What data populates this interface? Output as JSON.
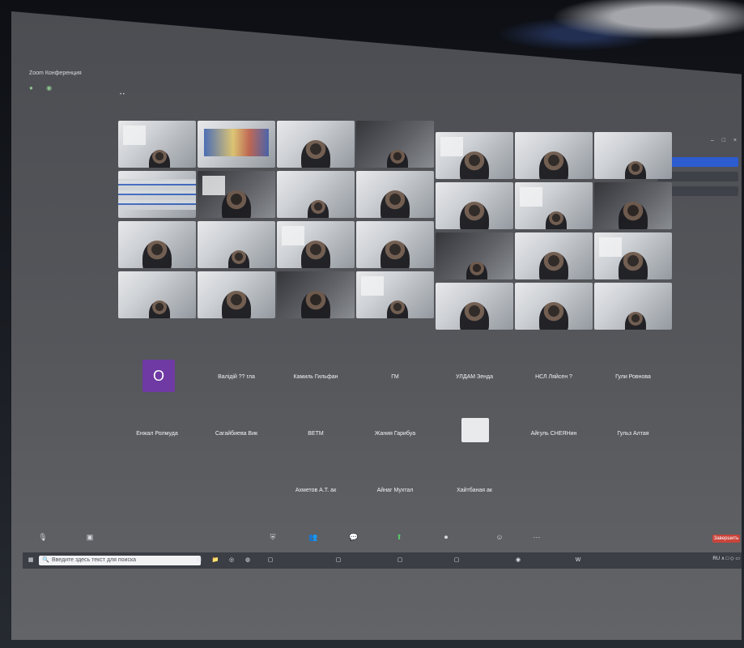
{
  "app": {
    "title": "Zoom Конференция"
  },
  "window": {
    "controls": [
      "–",
      "□",
      "×"
    ]
  },
  "view": {
    "dots": "• •"
  },
  "chat_panel": {
    "items": [
      {
        "label": ""
      },
      {
        "label": ""
      },
      {
        "label": ""
      }
    ]
  },
  "video_tiles": [
    {
      "kind": "person"
    },
    {
      "kind": "banner"
    },
    {
      "kind": "person"
    },
    {
      "kind": "person"
    },
    {
      "kind": "person"
    },
    {
      "kind": "person"
    },
    {
      "kind": "person"
    },
    {
      "kind": "shelf"
    },
    {
      "kind": "person"
    },
    {
      "kind": "person"
    },
    {
      "kind": "person"
    },
    {
      "kind": "person"
    },
    {
      "kind": "person"
    },
    {
      "kind": "person"
    },
    {
      "kind": "person"
    },
    {
      "kind": "person"
    },
    {
      "kind": "person"
    },
    {
      "kind": "person"
    },
    {
      "kind": "person"
    },
    {
      "kind": "person"
    },
    {
      "kind": "person"
    },
    {
      "kind": "person"
    },
    {
      "kind": "person"
    },
    {
      "kind": "person"
    },
    {
      "kind": "person"
    },
    {
      "kind": "person"
    },
    {
      "kind": "person"
    },
    {
      "kind": "person"
    }
  ],
  "nameplates": [
    {
      "avatar": "O",
      "name": "",
      "sub": ""
    },
    {
      "name": "Валідій ?? гла",
      "sub": ""
    },
    {
      "name": "Камиль Гильфан",
      "sub": ""
    },
    {
      "name": "ГМ",
      "sub": ""
    },
    {
      "name": "УЛДАМ  Зенда",
      "sub": ""
    },
    {
      "name": "НСЛ Ляйсен ?",
      "sub": ""
    },
    {
      "name": "Гули Ровнова",
      "sub": ""
    },
    {
      "name": "Енжал Ролмуда",
      "sub": ""
    },
    {
      "name": "Сагайбиева  Вик",
      "sub": ""
    },
    {
      "name": "ВЕТМ",
      "sub": ""
    },
    {
      "name": "Жания Гарибуа",
      "sub": ""
    },
    {
      "photo": true,
      "name": "",
      "sub": ""
    },
    {
      "name": "Айгуль СНЕЯНин",
      "sub": ""
    },
    {
      "name": "Гульз Алтая",
      "sub": ""
    },
    {
      "name": "Ахметов  А.Т. ак",
      "sub": ""
    },
    {
      "name": "Айнаг  Мухтал",
      "sub": ""
    },
    {
      "name": "Хайтбаная  ак",
      "sub": ""
    }
  ],
  "meeting_controls": {
    "end_label": "Завершить"
  },
  "taskbar": {
    "search_placeholder": "Введите здесь текст для поиска",
    "apps": [
      "",
      "",
      "",
      "",
      "",
      "",
      "",
      "",
      "",
      ""
    ],
    "tray": "RU  ∧  □  ◇  ▭"
  },
  "colors": {
    "screen_bg": "#4b4d52",
    "end_button": "#c9443b",
    "avatar_purple": "#6f3aa3",
    "accent_green": "#58c46a",
    "chat_active": "#2d5bd0"
  }
}
